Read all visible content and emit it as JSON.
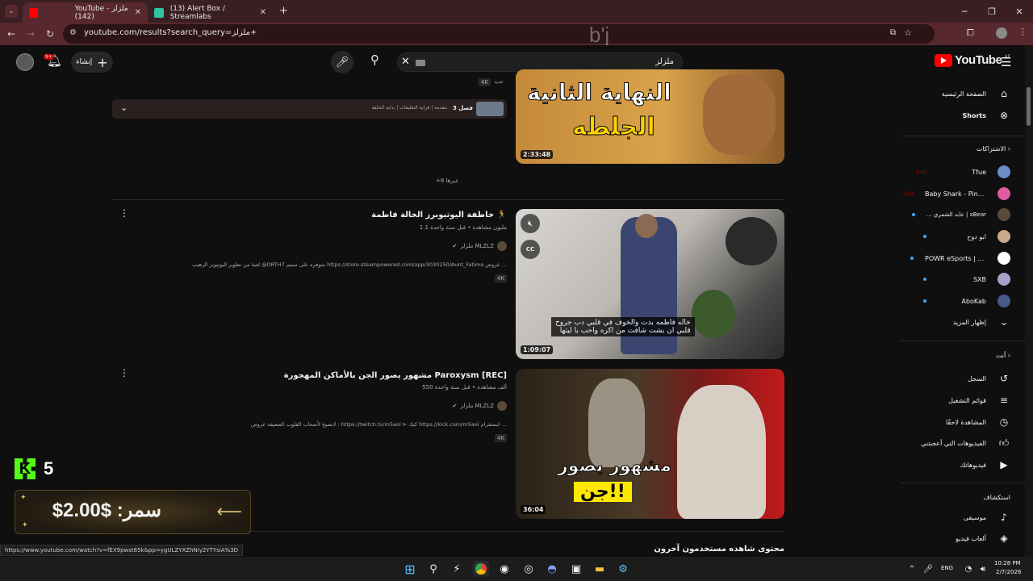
{
  "browser": {
    "tabs": [
      {
        "title": "YouTube - ملزلز (142)",
        "active": true
      },
      {
        "title": "(13) Alert Box / Streamlabs",
        "active": false
      }
    ],
    "url": "youtube.com/results?search_query=ملزلز+"
  },
  "youtube": {
    "search_query": "ملزلز",
    "create_label": "إنشاء",
    "notifications_count": "9+",
    "logo_text": "YouTube",
    "logo_country": "AE"
  },
  "sidebar": {
    "main": [
      {
        "label": "الصفحة الرئيسية",
        "icon": "home-icon"
      },
      {
        "label": "Shorts",
        "icon": "shorts-icon"
      }
    ],
    "subscriptions_heading": "الاشتراكات",
    "subscriptions": [
      {
        "label": "Tfue",
        "color": "#6a8cc7",
        "live": true
      },
      {
        "label": "Baby Shark - Pin...",
        "color": "#e05aa0",
        "live": true
      },
      {
        "label": "xBear | عابد الشمري ...",
        "color": "#5b4a3a",
        "dot": true
      },
      {
        "label": "ابو دوح",
        "color": "#c9a98a",
        "dot": true
      },
      {
        "label": "POWR eSports | ...",
        "color": "#ffffff",
        "dot": true
      },
      {
        "label": "SXB",
        "color": "#a8a0c8",
        "dot": true
      },
      {
        "label": "AboKab",
        "color": "#4a5a8a",
        "dot": true
      }
    ],
    "show_more": "إظهار المزيد",
    "you_heading": "أنت",
    "you_items": [
      {
        "label": "السجل",
        "icon": "history-icon"
      },
      {
        "label": "قوائم التشغيل",
        "icon": "playlist-icon"
      },
      {
        "label": "المشاهدة لاحقًا",
        "icon": "watch-later-icon"
      },
      {
        "label": "الفيديوهات التي أعجبتني",
        "icon": "like-icon"
      },
      {
        "label": "فيديوهاتك",
        "icon": "your-videos-icon"
      }
    ],
    "explore_heading": "استكشاف",
    "explore_items": [
      {
        "label": "موسيقى",
        "icon": "music-icon"
      },
      {
        "label": "ألعاب فيديو",
        "icon": "gaming-icon"
      }
    ]
  },
  "results": {
    "top_video": {
      "duration": "2:33:48",
      "thumb_text_1": "النهاية الثانية",
      "thumb_text_2": "الجلطه",
      "new_badge": "جديد",
      "badge": "4K"
    },
    "chapters": {
      "count_label": "3 فصل",
      "text": "مقدمة | قراية التعليقات | بداية الحلقة"
    },
    "more_label": "+8 غيرها",
    "videos": [
      {
        "title": "خاطفة اليوتيوبرز الخالة فاطمة 🏃",
        "meta": "1.1 مليون مشاهدة • قبل سنة واحدة",
        "channel": "ملزلز MLZLZ",
        "desc": "لعبة من تطوير اليوتيوبر الرهيب @DRTH7 متوفره على ستيم https://store.steampowered.com/app/3030250/Aunt_Fatima عروض ...",
        "badge": "4K",
        "duration": "1:09:07",
        "caption_1": "خاله فاطمه بدت والخوف في قلبي دب جروح",
        "caption_2": "قلبي ان بشت شافت من اكره واحب يا ليتها"
      },
      {
        "title": "مشهور يصور الجن بالأماكن المهجورة Paroxysm [REC]",
        "meta": "550 ألف مشاهدة • قبل سنة واحدة",
        "channel": "ملزلز MLZLZ",
        "desc": "لانصيح لأصحاب القلوب الضعيفة عروض : https://twitch.tv/m5aoi ⊳ كيك https://kick.com/m5aoi انستقرام ...",
        "badge": "4K",
        "duration": "36:04",
        "thumb_text_1": "مشهور يصور",
        "thumb_text_2": "جن!!"
      }
    ],
    "next_section": "محتوى شاهده مستخدمون آخرون"
  },
  "overlay": {
    "kick_count": "5",
    "donation": "سمر: $2.00$",
    "watermark": "b'j"
  },
  "statusbar_url": "https://www.youtube.com/watch?v=fEX9pwst65k&pp=ygULZYXZhNiy2YTYsiA%3D",
  "taskbar": {
    "lang": "ENG",
    "time": "10:28 PM",
    "date": "2/7/2026"
  }
}
